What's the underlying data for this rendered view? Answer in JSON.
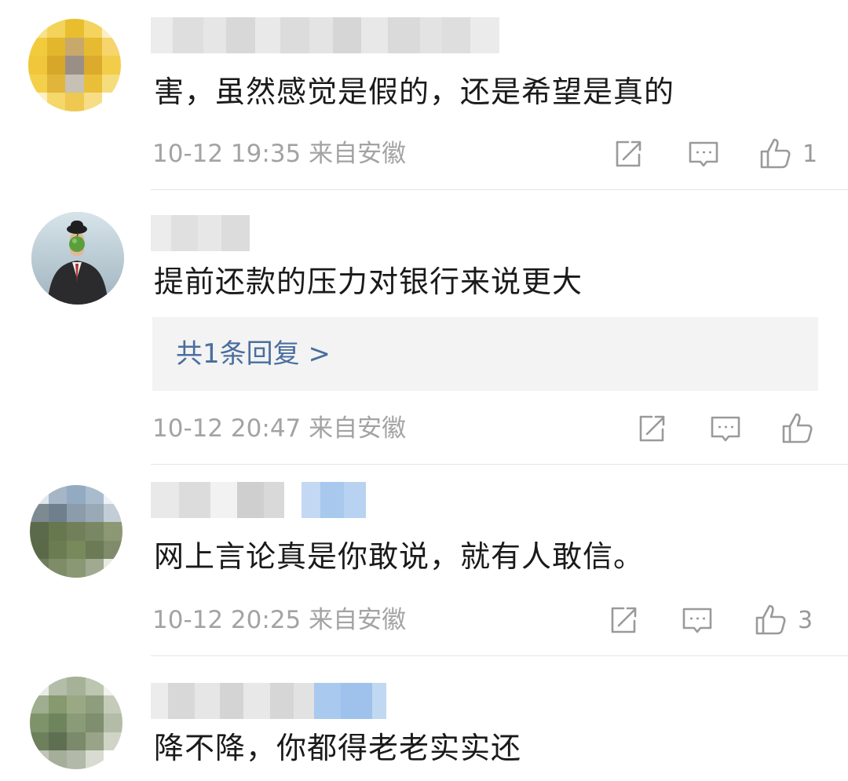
{
  "comments": [
    {
      "text": "害，虽然感觉是假的，还是希望是真的",
      "time": "10-12 19:35",
      "location": "来自安徽",
      "like_count": "1",
      "avatar_icon": "pixelated-avatar",
      "username_blurred": true
    },
    {
      "text": "提前还款的压力对银行来说更大",
      "time": "10-12 20:47",
      "location": "来自安徽",
      "like_count": "",
      "avatar_icon": "man-in-bowler-hat-avatar",
      "reply_summary": "共1条回复 >",
      "username_blurred": true
    },
    {
      "text": "网上言论真是你敢说，就有人敢信。",
      "time": "10-12 20:25",
      "location": "来自安徽",
      "like_count": "3",
      "avatar_icon": "pixelated-avatar",
      "username_blurred": true
    },
    {
      "text": "降不降，你都得老老实实还",
      "avatar_icon": "pixelated-avatar",
      "username_blurred": true
    }
  ],
  "icons": {
    "share": "share-icon",
    "reply": "comment-icon",
    "like": "thumbs-up-icon"
  },
  "colors": {
    "link": "#4a6e9f",
    "meta": "#a3a3a3",
    "divider": "#e6e6e6"
  }
}
